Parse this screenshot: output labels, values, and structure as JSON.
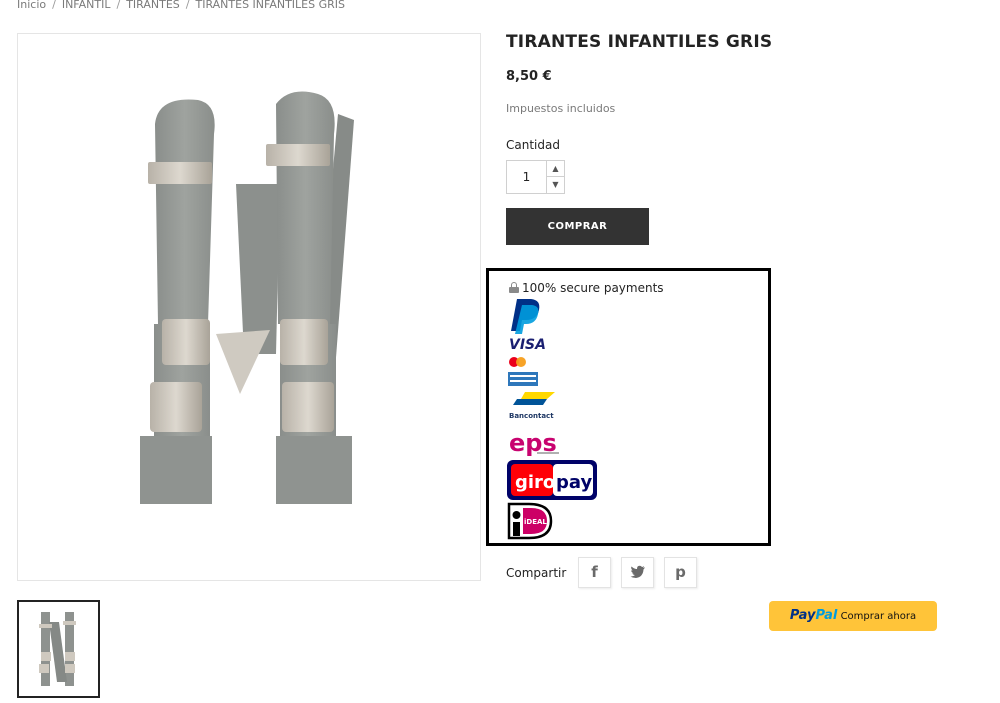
{
  "breadcrumb": [
    "Inicio",
    "INFANTIL",
    "TIRANTES",
    "TIRANTES INFANTILES GRIS"
  ],
  "breadcrumb_separator": "/",
  "product": {
    "title": "TIRANTES INFANTILES GRIS",
    "price": "8,50 €",
    "tax_note": "Impuestos incluidos",
    "quantity_label": "Cantidad",
    "quantity_value": "1",
    "buy_label": "COMPRAR",
    "image_icon": "suspenders-photo",
    "thumbnail_icon": "suspenders-thumbnail"
  },
  "payments": {
    "heading": "100% secure payments",
    "lock_icon": "lock-icon",
    "methods": [
      {
        "name": "PayPal",
        "icon": "paypal-icon"
      },
      {
        "name": "VISA",
        "icon": "visa-icon"
      },
      {
        "name": "Mastercard",
        "icon": "mastercard-icon"
      },
      {
        "name": "American Express",
        "icon": "amex-icon"
      },
      {
        "name": "Bancontact",
        "icon": "bancontact-icon"
      },
      {
        "name": "eps",
        "icon": "eps-icon"
      },
      {
        "name": "giropay",
        "icon": "giropay-icon"
      },
      {
        "name": "iDEAL",
        "icon": "ideal-icon"
      }
    ],
    "giropay_left": "giro",
    "giropay_right": "pay",
    "bancontact_text": "Bancontact",
    "visa_text": "VISA",
    "eps_text": "eps",
    "ideal_text": "iDEAL"
  },
  "share": {
    "label": "Compartir",
    "facebook_glyph": "f",
    "twitter_glyph": "t",
    "pinterest_glyph": "p"
  },
  "paypal_button": {
    "brand_pay": "Pay",
    "brand_pal": "Pal",
    "label": "Comprar ahora"
  },
  "colors": {
    "buy_button": "#333333",
    "paypal_yellow": "#ffc439",
    "paypal_dark_blue": "#003087",
    "paypal_light_blue": "#009cde",
    "giropay_navy": "#000268",
    "giropay_red": "#ff0007",
    "eps_pink": "#c8036f",
    "ideal_pink": "#cc0066",
    "bancontact_yellow": "#ffd800",
    "bancontact_blue": "#005498"
  }
}
